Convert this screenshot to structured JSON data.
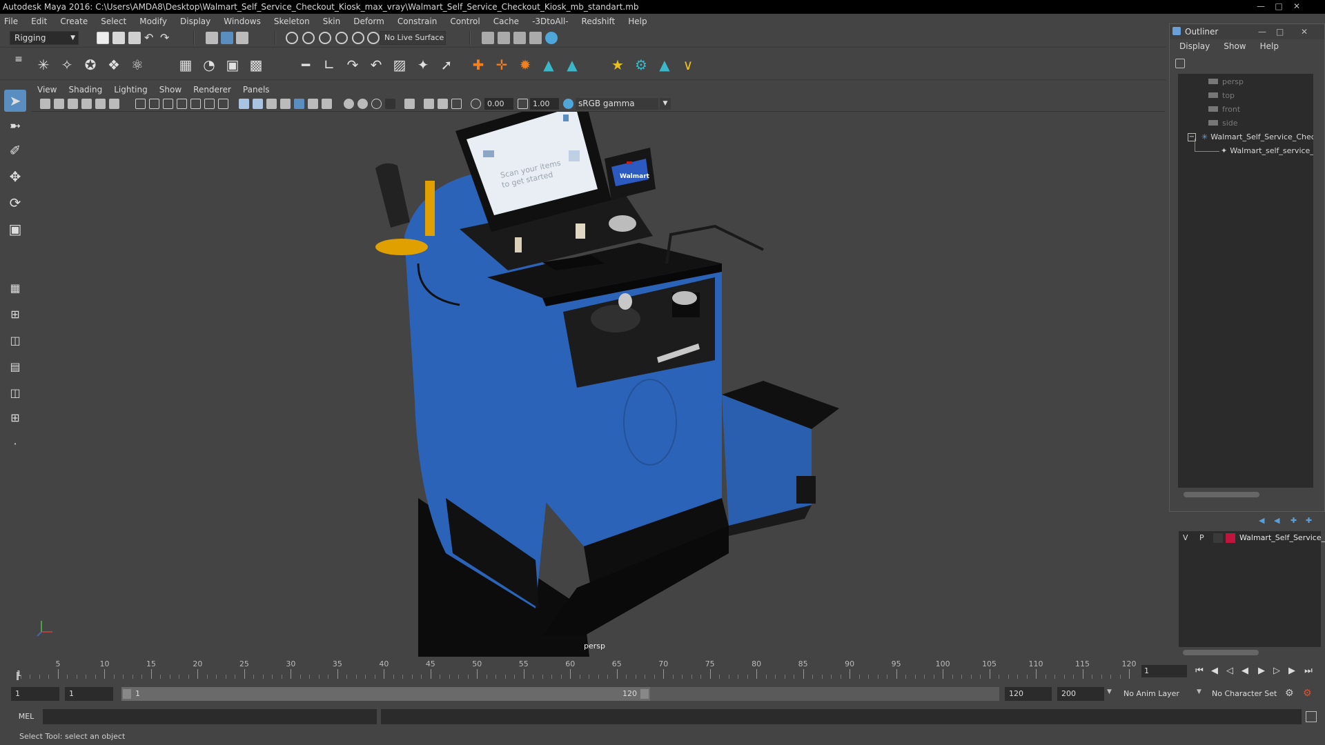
{
  "window": {
    "title": "Autodesk Maya 2016: C:\\Users\\AMDA8\\Desktop\\Walmart_Self_Service_Checkout_Kiosk_max_vray\\Walmart_Self_Service_Checkout_Kiosk_mb_standart.mb"
  },
  "menu": [
    "File",
    "Edit",
    "Create",
    "Select",
    "Modify",
    "Display",
    "Windows",
    "Skeleton",
    "Skin",
    "Deform",
    "Constrain",
    "Control",
    "Cache",
    "-3DtoAll-",
    "Redshift",
    "Help"
  ],
  "statusline": {
    "menuset": "Rigging",
    "live_surface": "No Live Surface"
  },
  "panel": {
    "menu": [
      "View",
      "Shading",
      "Lighting",
      "Show",
      "Renderer",
      "Panels"
    ],
    "exposure": "0.00",
    "gamma": "1.00",
    "color_space": "sRGB gamma",
    "camera_label": "persp"
  },
  "kiosk_screen": {
    "line1": "Scan your items",
    "line2": "to get started",
    "logo": "Walmart"
  },
  "outliner": {
    "title": "Outliner",
    "menu": [
      "Display",
      "Show",
      "Help"
    ],
    "items": [
      {
        "label": "persp",
        "type": "camera"
      },
      {
        "label": "top",
        "type": "camera"
      },
      {
        "label": "front",
        "type": "camera"
      },
      {
        "label": "side",
        "type": "camera"
      },
      {
        "label": "Walmart_Self_Service_Chec",
        "type": "group"
      },
      {
        "label": "Walmart_self_service_k",
        "type": "mesh"
      }
    ]
  },
  "layers": {
    "rows": [
      {
        "v": "V",
        "p": "P",
        "color": "#c0143c",
        "name": "Walmart_Self_Service_"
      }
    ]
  },
  "timeline": {
    "ticks": [
      5,
      10,
      15,
      20,
      25,
      30,
      35,
      40,
      45,
      50,
      55,
      60,
      65,
      70,
      75,
      80,
      85,
      90,
      95,
      100,
      105,
      110,
      115,
      120
    ],
    "start_label": "1",
    "current_frame": "1"
  },
  "range": {
    "start": "1",
    "playback_start": "1",
    "slider_start": "1",
    "slider_end": "120",
    "playback_end": "120",
    "end": "200",
    "anim_layer": "No Anim Layer",
    "character_set": "No Character Set"
  },
  "command": {
    "lang": "MEL",
    "help_text": "Select Tool: select an object"
  }
}
